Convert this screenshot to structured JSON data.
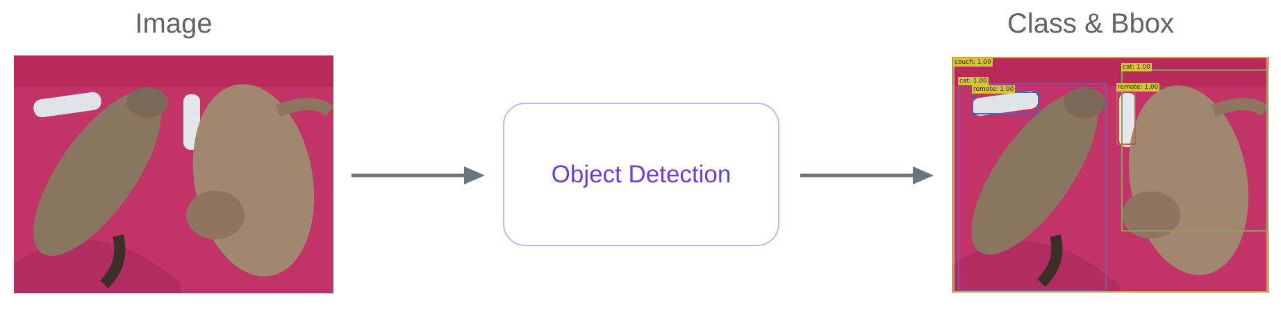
{
  "titles": {
    "input": "Image",
    "output": "Class & Bbox"
  },
  "process": {
    "label": "Object Detection"
  },
  "detections": [
    {
      "label": "couch: 1.00",
      "color": "#e0a040"
    },
    {
      "label": "cat: 1.00",
      "color": "#7b5aa6"
    },
    {
      "label": "remote: 1.00",
      "color": "#3b6bb8"
    },
    {
      "label": "cat: 1.00",
      "color": "#8aa050"
    },
    {
      "label": "remote: 1.00",
      "color": "#c06040"
    }
  ],
  "colors": {
    "title": "#5f6368",
    "box_border": "#c9b4f2",
    "box_text": "#6a3fd6",
    "arrow": "#6b7280",
    "blanket": "#c8336c"
  }
}
